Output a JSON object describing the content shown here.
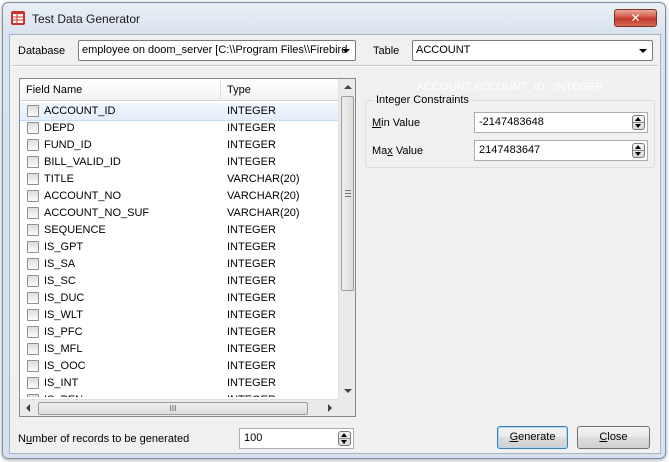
{
  "window": {
    "title": "Test Data Generator",
    "close_label": "✕"
  },
  "toolbar": {
    "database_label": "Database",
    "database_value": "employee on doom_server [C:\\\\Program Files\\\\Firebird",
    "table_label": "Table",
    "table_value": "ACCOUNT"
  },
  "fields_list": {
    "columns": [
      "Field Name",
      "Type"
    ],
    "rows": [
      {
        "name": "ACCOUNT_ID",
        "type": "INTEGER",
        "selected": true
      },
      {
        "name": "DEPD",
        "type": "INTEGER"
      },
      {
        "name": "FUND_ID",
        "type": "INTEGER"
      },
      {
        "name": "BILL_VALID_ID",
        "type": "INTEGER"
      },
      {
        "name": "TITLE",
        "type": "VARCHAR(20)"
      },
      {
        "name": "ACCOUNT_NO",
        "type": "VARCHAR(20)"
      },
      {
        "name": "ACCOUNT_NO_SUF",
        "type": "VARCHAR(20)"
      },
      {
        "name": "SEQUENCE",
        "type": "INTEGER"
      },
      {
        "name": "IS_GPT",
        "type": "INTEGER"
      },
      {
        "name": "IS_SA",
        "type": "INTEGER"
      },
      {
        "name": "IS_SC",
        "type": "INTEGER"
      },
      {
        "name": "IS_DUC",
        "type": "INTEGER"
      },
      {
        "name": "IS_WLT",
        "type": "INTEGER"
      },
      {
        "name": "IS_PFC",
        "type": "INTEGER"
      },
      {
        "name": "IS_MFL",
        "type": "INTEGER"
      },
      {
        "name": "IS_OOC",
        "type": "INTEGER"
      },
      {
        "name": "IS_INT",
        "type": "INTEGER"
      },
      {
        "name": "IS_PEN",
        "type": "INTEGER"
      }
    ],
    "hscroll_grip": "III"
  },
  "field_caption": "ACCOUNT.ACCOUNT_ID - INTEGER",
  "constraints": {
    "group_title": "Integer Constraints",
    "min_label": "Min Value",
    "min_value": "-2147483648",
    "max_label": "Max Value",
    "max_value": "2147483647"
  },
  "footer": {
    "records_label": "Number of records to be generated",
    "records_value": "100",
    "generate_label": "Generate",
    "close_label": "Close"
  }
}
